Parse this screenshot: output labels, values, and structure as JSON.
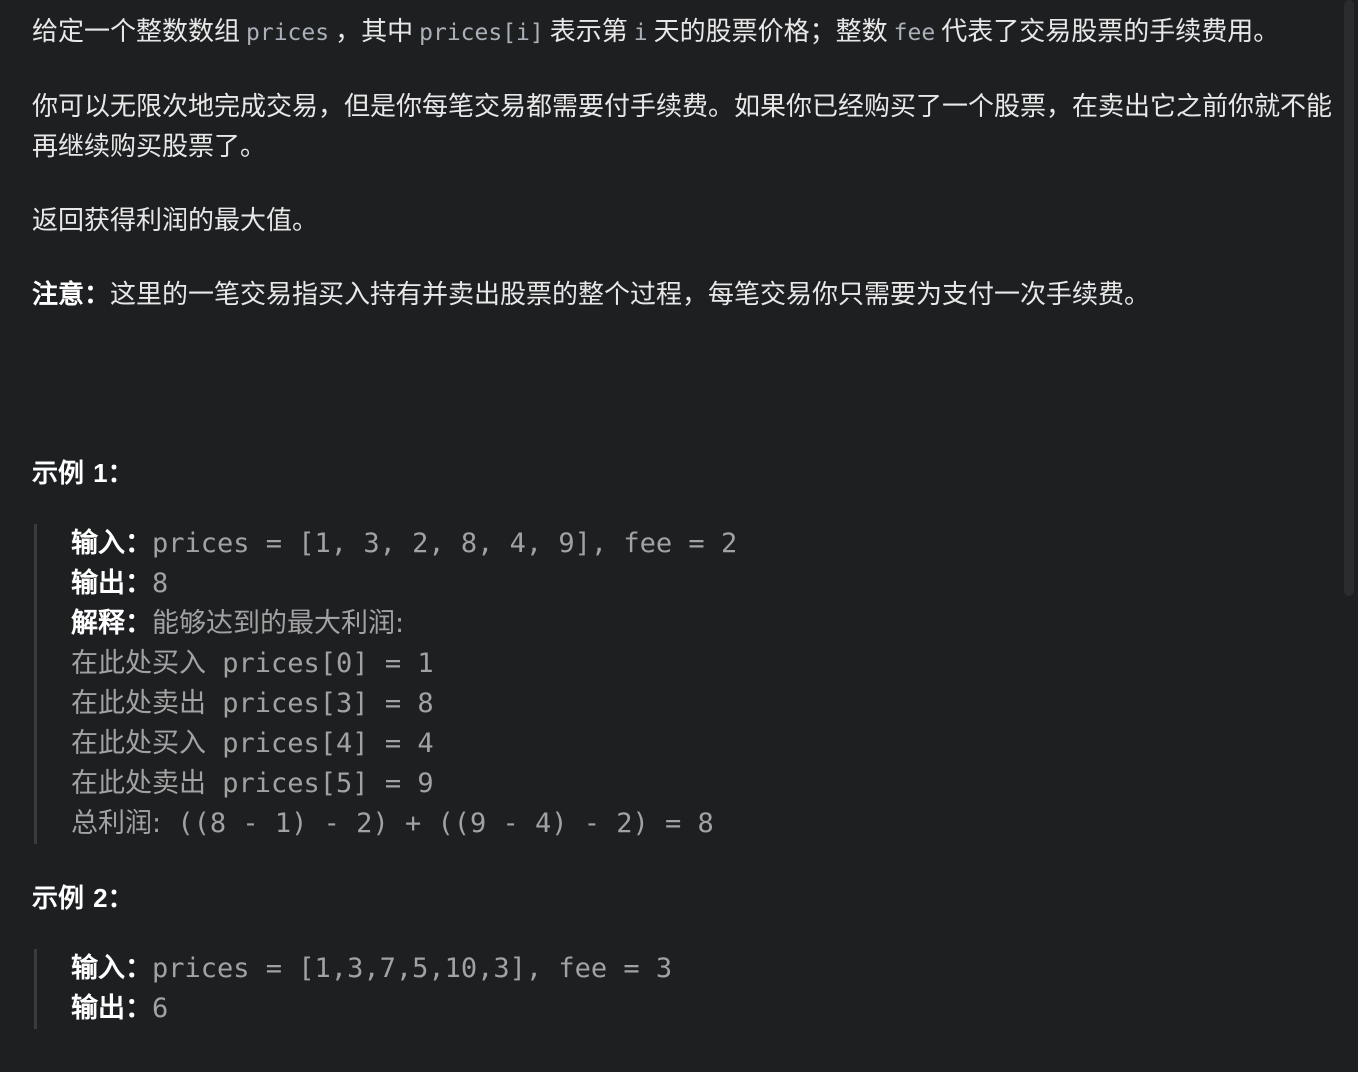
{
  "description": {
    "p1_a": "给定一个整数数组",
    "p1_code1": "prices",
    "p1_b": "，其中",
    "p1_code2": "prices[i]",
    "p1_c": "表示第",
    "p1_code3": "i",
    "p1_d": "天的股票价格；整数",
    "p1_code4": "fee",
    "p1_e": "代表了交易股票的手续费用。",
    "p2": "你可以无限次地完成交易，但是你每笔交易都需要付手续费。如果你已经购买了一个股票，在卖出它之前你就不能再继续购买股票了。",
    "p3": "返回获得利润的最大值。",
    "note_label": "注意：",
    "note_text": "这里的一笔交易指买入持有并卖出股票的整个过程，每笔交易你只需要为支付一次手续费。"
  },
  "examples": [
    {
      "title_prefix": "示例 ",
      "title_num": "1",
      "title_suffix": "：",
      "input_label": "输入：",
      "input": "prices = [1, 3, 2, 8, 4, 9], fee = 2",
      "output_label": "输出：",
      "output": "8",
      "explain_label": "解释：",
      "explain_head": "能够达到的最大利润:",
      "steps": [
        {
          "text": "在此处买入",
          "code": "prices[0] = 1"
        },
        {
          "text": "在此处卖出",
          "code": "prices[3] = 8"
        },
        {
          "text": "在此处买入",
          "code": "prices[4] = 4"
        },
        {
          "text": "在此处卖出",
          "code": "prices[5] = 9"
        }
      ],
      "total_label": "总利润:",
      "total": "((8 - 1) - 2) + ((9 - 4) - 2) = 8"
    },
    {
      "title_prefix": "示例 ",
      "title_num": "2",
      "title_suffix": "：",
      "input_label": "输入：",
      "input": "prices = [1,3,7,5,10,3], fee = 3",
      "output_label": "输出：",
      "output": "6"
    }
  ]
}
